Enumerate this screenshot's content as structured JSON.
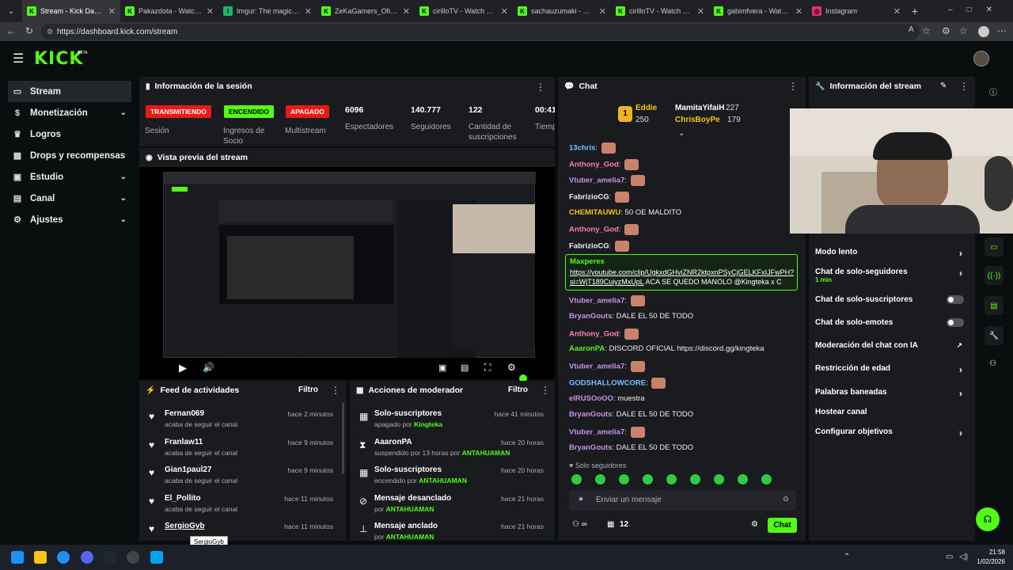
{
  "browser": {
    "tabs": [
      {
        "title": "Stream - Kick Dashboard",
        "fav": "K",
        "color": "#53fc18"
      },
      {
        "title": "Pakazdota - Watch clips",
        "fav": "K",
        "color": "#53fc18"
      },
      {
        "title": "Imgur: The magic of the",
        "fav": "I",
        "color": "#1bb76e"
      },
      {
        "title": "ZeKaGamers_Oficial - W",
        "fav": "K",
        "color": "#53fc18"
      },
      {
        "title": "cirilloTV - Watch clips on",
        "fav": "K",
        "color": "#53fc18"
      },
      {
        "title": "sachauzumaki - Watch c",
        "fav": "K",
        "color": "#53fc18"
      },
      {
        "title": "cirilloTV - Watch clips on",
        "fav": "K",
        "color": "#53fc18"
      },
      {
        "title": "gabimfvera - Watch clip",
        "fav": "K",
        "color": "#53fc18"
      },
      {
        "title": "Instagram",
        "fav": "◎",
        "color": "#e1306c"
      }
    ],
    "url": "https://dashboard.kick.com/stream"
  },
  "app": {
    "logo": "KICK",
    "logo_sup": "BETA"
  },
  "sidebar": {
    "items": [
      {
        "label": "Stream",
        "icon": "video-icon"
      },
      {
        "label": "Monetización",
        "icon": "dollar-icon"
      },
      {
        "label": "Logros",
        "icon": "trophy-icon"
      },
      {
        "label": "Drops y recompensas",
        "icon": "gift-icon"
      },
      {
        "label": "Estudio",
        "icon": "studio-icon"
      },
      {
        "label": "Canal",
        "icon": "channel-icon"
      },
      {
        "label": "Ajustes",
        "icon": "gear-icon"
      }
    ]
  },
  "session": {
    "title": "Información de la sesión",
    "badges": [
      {
        "label": "TRANSMITIENDO",
        "color": "#e91916",
        "sub": "Sesión"
      },
      {
        "label": "ENCENDIDO",
        "color": "#53fc18",
        "sub": "Ingresos de Socio"
      },
      {
        "label": "APAGADO",
        "color": "#e91916",
        "sub": "Multistream"
      }
    ],
    "stats": [
      {
        "value": "6096",
        "label": "Espectadores"
      },
      {
        "value": "140.777",
        "label": "Seguidores"
      },
      {
        "value": "122",
        "label": "Cantidad de suscripciones"
      },
      {
        "value": "00:41",
        "label": "Tiempo en vivo"
      }
    ]
  },
  "preview": {
    "title": "Vista previa del stream"
  },
  "feed": {
    "title": "Feed de actividades",
    "filter": "Filtro",
    "items": [
      {
        "name": "Fernan069",
        "sub": "acaba de seguir el canal",
        "time": "hace 2 minutos"
      },
      {
        "name": "Franlaw11",
        "sub": "acaba de seguir el canal",
        "time": "hace 9 minutos"
      },
      {
        "name": "Gian1paul27",
        "sub": "acaba de seguir el canal",
        "time": "hace 9 minutos"
      },
      {
        "name": "El_Pollito",
        "sub": "acaba de seguir el canal",
        "time": "hace 11 minutos"
      },
      {
        "name": "SergioGyb",
        "sub": "",
        "time": "hace 11 minutos"
      }
    ],
    "tooltip": "SergioGyb"
  },
  "mod": {
    "title": "Acciones de moderador",
    "filter": "Filtro",
    "items": [
      {
        "name": "Solo-suscriptores",
        "pre": "apagado por",
        "who": "Kingteka",
        "time": "hace 41 minutos",
        "icon": "gift-icon"
      },
      {
        "name": "AaaronPA",
        "pre": "suspendido por 13 horas por",
        "who": "ANTAHUAMAN",
        "time": "hace 20 horas",
        "icon": "hourglass-icon"
      },
      {
        "name": "Solo-suscriptores",
        "pre": "encendido por",
        "who": "ANTAHUAMAN",
        "time": "hace 20 horas",
        "icon": "gift-icon"
      },
      {
        "name": "Mensaje desanclado",
        "pre": "por",
        "who": "ANTAHUAMAN",
        "time": "hace 21 horas",
        "icon": "unpin-icon"
      },
      {
        "name": "Mensaje anclado",
        "pre": "por",
        "who": "ANTAHUAMAN",
        "time": "hace 21 horas",
        "icon": "pin-icon"
      }
    ]
  },
  "chat": {
    "title": "Chat",
    "top": [
      {
        "rank": "1",
        "name": "Eddie",
        "amount": "250"
      },
      {
        "name": "MamitaYifaiH",
        "amount": "227"
      },
      {
        "name": "ChrisBoyPe",
        "amount": "179"
      }
    ],
    "messages": [
      {
        "user": "13chris",
        "text": "",
        "color": "#6ec6ff"
      },
      {
        "user": "Anthony_God",
        "text": "",
        "color": "#ff7eb6"
      },
      {
        "user": "Vtuber_amelia7",
        "text": "",
        "color": "#c792ea"
      },
      {
        "user": "FabrizioCG",
        "text": "",
        "color": "#efeff1"
      },
      {
        "user": "CHEMITAUWU",
        "text": "50 OE MALDITO",
        "color": "#f5c518"
      },
      {
        "user": "Anthony_God",
        "text": "",
        "color": "#ff7eb6"
      },
      {
        "user": "FabrizioCG",
        "text": "",
        "color": "#efeff1"
      },
      {
        "user": "Vtuber_amelia7",
        "text": "",
        "color": "#c792ea"
      },
      {
        "user": "BryanGouts",
        "text": "DALE EL 50 DE TODO",
        "color": "#c792ea"
      },
      {
        "user": "Anthony_God",
        "text": "",
        "color": "#ff7eb6"
      },
      {
        "user": "AaaronPA",
        "text": "DISCORD OFICIAL  https://discord.gg/kingteka",
        "color": "#53fc18"
      },
      {
        "user": "Vtuber_amelia7",
        "text": "",
        "color": "#c792ea"
      },
      {
        "user": "GODSHALLOWCORE",
        "text": "",
        "color": "#6ec6ff"
      },
      {
        "user": "elRUSOoOO",
        "text": "muestra",
        "color": "#c792ea"
      },
      {
        "user": "BryanGouts",
        "text": "DALE EL 50 DE TODO",
        "color": "#c792ea"
      },
      {
        "user": "Vtuber_amelia7",
        "text": "",
        "color": "#c792ea"
      },
      {
        "user": "BryanGouts",
        "text": "DALE EL 50 DE TODO",
        "color": "#c792ea"
      }
    ],
    "highlight": {
      "user": "Maxperes",
      "link": "https://youtube.com/clip/UgkxdGHviZNR2ktpxnPSyCjGELKFxIJFwPH?si=WjT189CuiyzMxUpL",
      "rest": "ACA SE QUEDO MANOLO @Kingteka x C"
    },
    "followers_only": "Solo seguidores",
    "placeholder": "Enviar un mensaje",
    "viewers_count": "12",
    "send": "Chat"
  },
  "stream_info": {
    "title": "Información del stream",
    "rows": [
      {
        "label": "Modo lento",
        "control": "arrow"
      },
      {
        "label": "Chat de solo-seguidores",
        "sub": "1 min",
        "control": "arrow"
      },
      {
        "label": "Chat de solo-suscriptores",
        "control": "toggle"
      },
      {
        "label": "Chat de solo-emotes",
        "control": "toggle"
      },
      {
        "label": "Moderación del chat con IA",
        "control": "external"
      },
      {
        "label": "Restricción de edad",
        "control": "arrow"
      },
      {
        "label": "Palabras baneadas",
        "control": "arrow"
      },
      {
        "label": "Hostear canal",
        "control": "none"
      },
      {
        "label": "Configurar objetivos",
        "control": "arrow"
      }
    ]
  },
  "taskbar": {
    "time": "21:58",
    "date": "1/02/2026"
  }
}
